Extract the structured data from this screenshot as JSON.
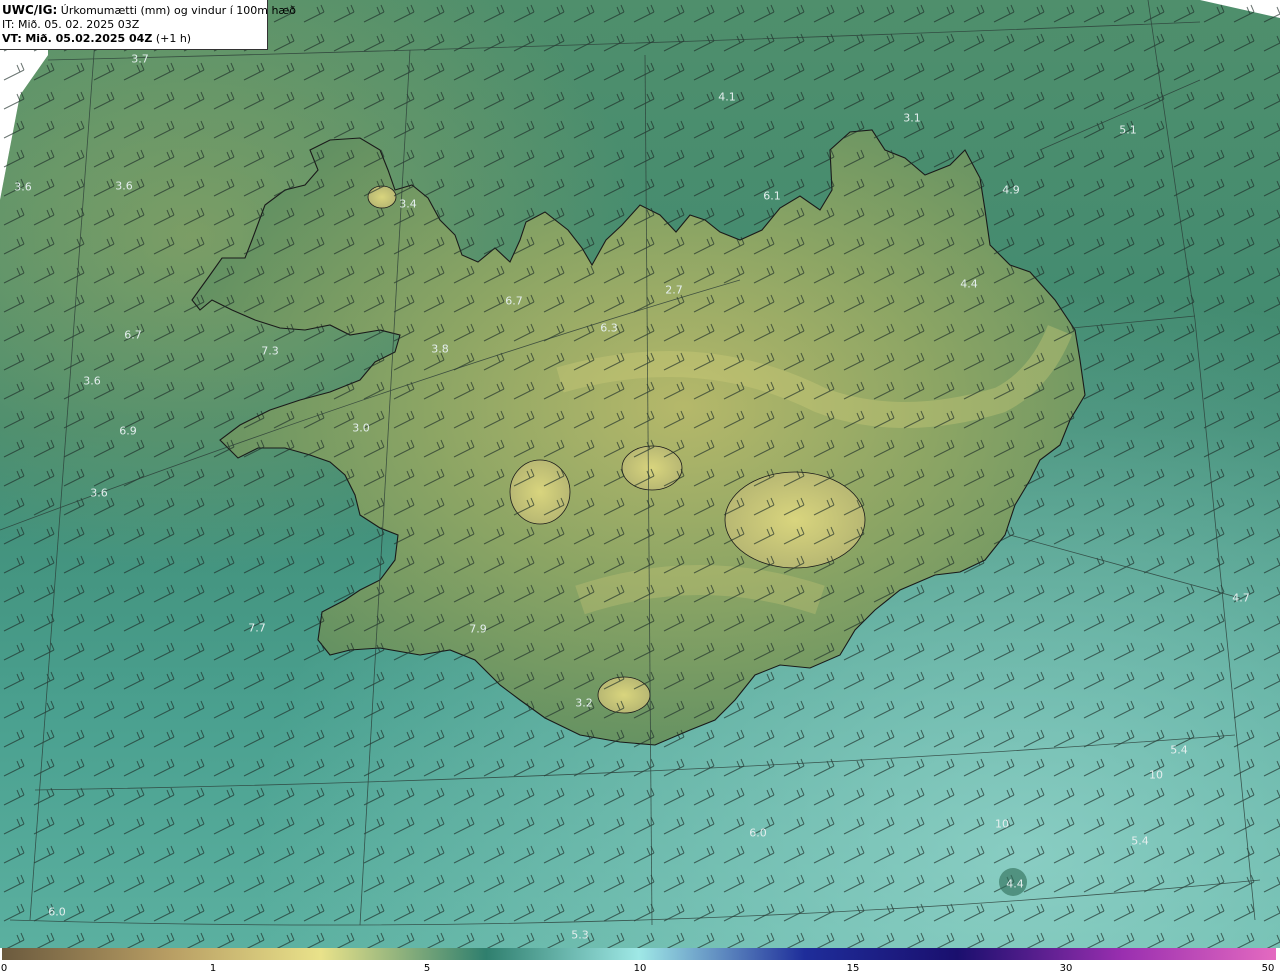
{
  "header": {
    "model": "UWC/IG:",
    "description": "Úrkomumætti (mm) og vindur í 100m hæð",
    "issue_time": "IT: Mið. 05. 02. 2025 03Z",
    "valid_prefix": "VT:",
    "valid_time": "Mið. 05.02.2025 04Z",
    "valid_offset": "(+1 h)"
  },
  "values": [
    "3.7",
    "4.1",
    "3.1",
    "5.1",
    "3.6",
    "3.6",
    "3.4",
    "6.1",
    "4.9",
    "4.4",
    "2.7",
    "6.7",
    "6.3",
    "6.7",
    "7.3",
    "3.8",
    "3.6",
    "3.0",
    "6.9",
    "3.6",
    "4.7",
    "7.7",
    "7.9",
    "3.2",
    "5.4",
    "10",
    "6.0",
    "10",
    "5.4",
    "4.4",
    "5.3",
    "6.0"
  ],
  "colorbar": {
    "ticks": [
      "0",
      "1",
      "5",
      "10",
      "15",
      "30",
      "50"
    ],
    "colors": [
      "#6b5a3e",
      "#b79d63",
      "#e9e28a",
      "#2f7f6e",
      "#9fe8e6",
      "#1e2d9a",
      "#1a0f6e",
      "#9a2fb0",
      "#e46ac0"
    ]
  },
  "colors": {
    "sea_base": "#3a8a74",
    "land_base": "#6f9a5c",
    "coast": "#1a1a1a",
    "label": "#e4eeee"
  }
}
